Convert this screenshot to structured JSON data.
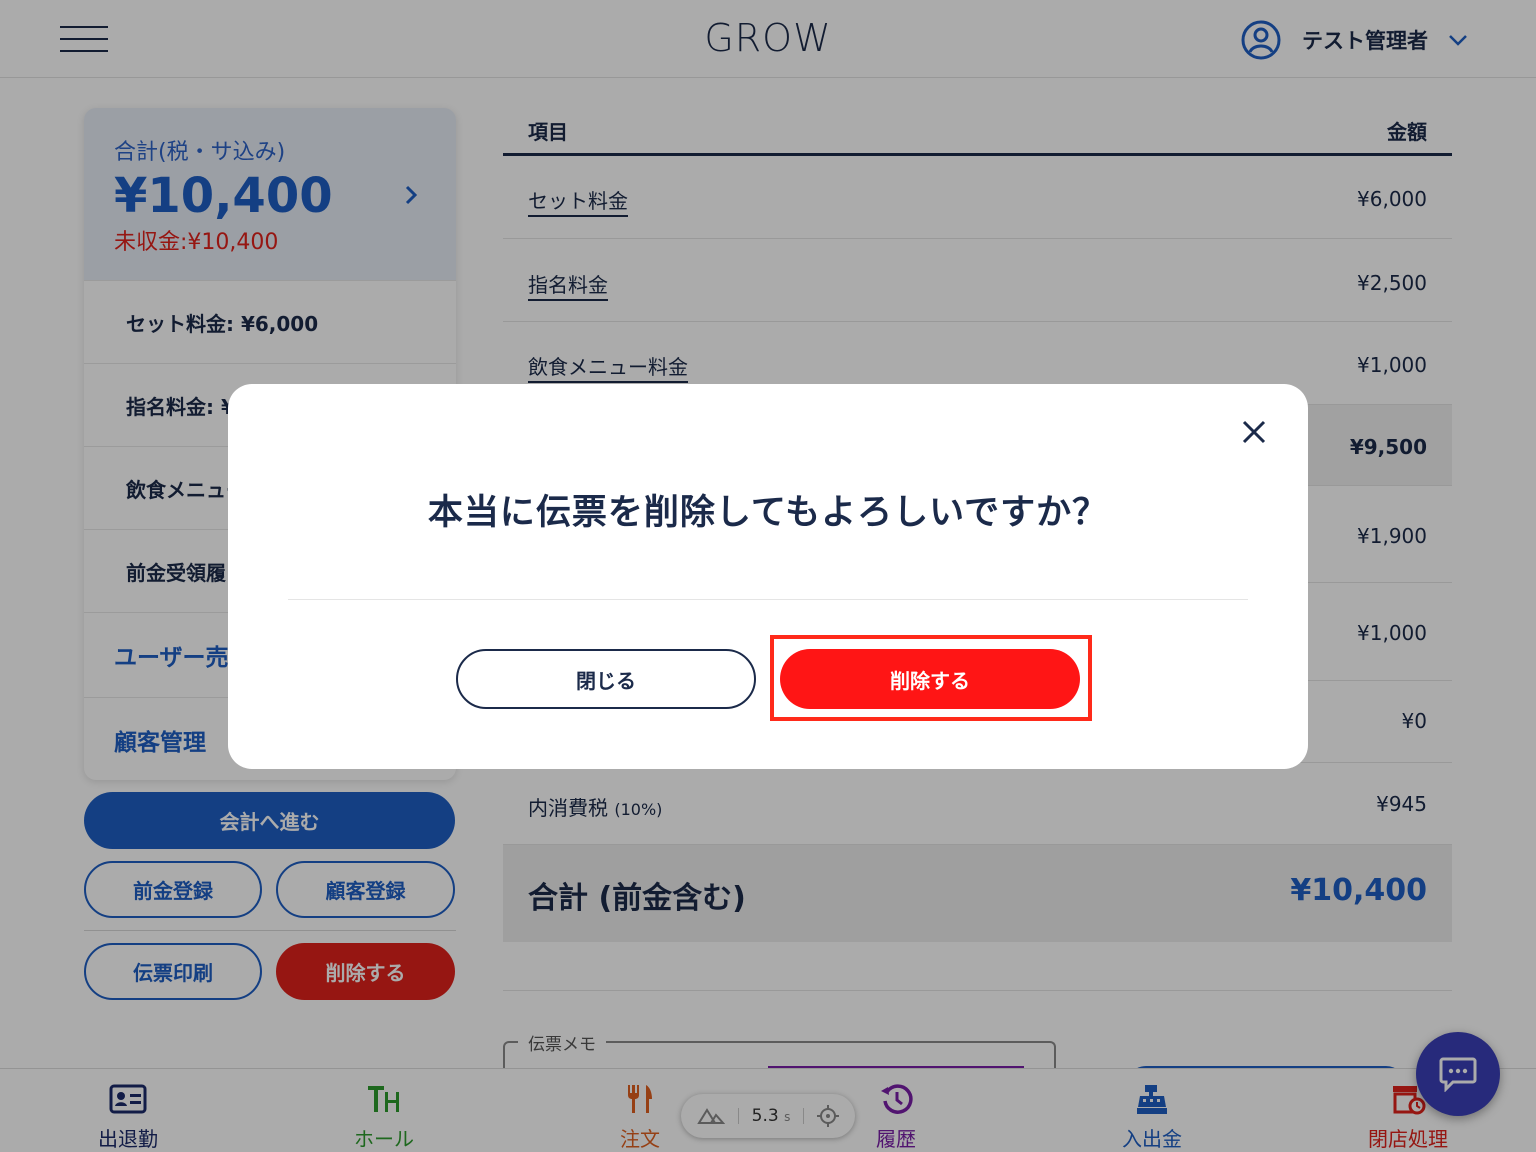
{
  "header": {
    "app_title": "GROW",
    "user_name": "テスト管理者"
  },
  "summary": {
    "total_label": "合計(税・サ込み)",
    "total_amount": "¥10,400",
    "unpaid": "未収金:¥10,400",
    "rows": [
      {
        "label": "セット料金: ¥6,000"
      },
      {
        "label": "指名料金: ¥"
      },
      {
        "label": "飲食メニュー"
      },
      {
        "label": "前金受領履"
      }
    ],
    "links": [
      {
        "label": "ユーザー売"
      },
      {
        "label": "顧客管理"
      }
    ]
  },
  "actions": {
    "checkout": "会計へ進む",
    "advance_register": "前金登録",
    "customer_register": "顧客登録",
    "print_slip": "伝票印刷",
    "delete": "削除する"
  },
  "table": {
    "header_item": "項目",
    "header_amount": "金額",
    "rows": [
      {
        "label": "セット料金",
        "value": "¥6,000"
      },
      {
        "label": "指名料金",
        "value": "¥2,500"
      },
      {
        "label": "飲食メニュー料金",
        "value": "¥1,000"
      },
      {
        "label": "",
        "value": "¥9,500"
      },
      {
        "label": "",
        "value": "¥1,900"
      },
      {
        "label": "",
        "value": "¥1,000"
      },
      {
        "label": "",
        "value": "¥0"
      },
      {
        "label": "内消費税",
        "label_suffix": "(10%)",
        "value": "¥945"
      }
    ],
    "total_label": "合計 (前金含む)",
    "total_value": "¥10,400"
  },
  "memo": {
    "label": "伝票メモ"
  },
  "bottom_nav": {
    "items": [
      {
        "label": "出退勤",
        "icon": "id-card-icon",
        "color": "#1b2a6a"
      },
      {
        "label": "ホール",
        "icon": "table-icon",
        "color": "#2e9b2e"
      },
      {
        "label": "注文",
        "icon": "fork-knife-icon",
        "color": "#e06020"
      },
      {
        "label": "履歴",
        "icon": "history-icon",
        "color": "#7a1fa8"
      },
      {
        "label": "入出金",
        "icon": "cash-register-icon",
        "color": "#1e5fc4"
      },
      {
        "label": "閉店処理",
        "icon": "store-close-icon",
        "color": "#e0221b"
      }
    ]
  },
  "debug": {
    "timer": "5.3",
    "unit": "s"
  },
  "modal": {
    "title": "本当に伝票を削除してもよろしいですか？",
    "close_label": "閉じる",
    "delete_label": "削除する"
  }
}
